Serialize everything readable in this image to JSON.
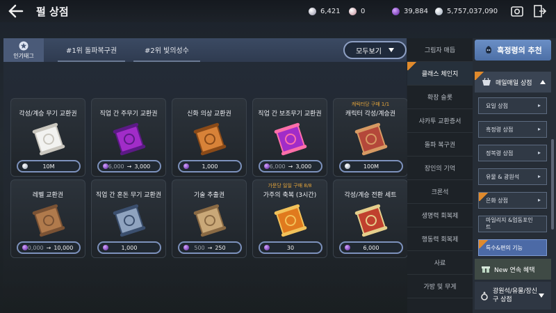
{
  "header": {
    "title": "펄 상점",
    "currencies": [
      {
        "icon": "pearl-icon",
        "value": "6,421",
        "color": "#c7c5d6"
      },
      {
        "icon": "pink-pearl-icon",
        "value": "0",
        "color": "#e4b6c1"
      },
      {
        "icon": "purple-gem-icon",
        "value": "39,884",
        "color": "#8e4fd6"
      },
      {
        "icon": "silver-coin-icon",
        "value": "5,757,037,090",
        "color": "#d5dae3"
      }
    ]
  },
  "tabs": {
    "popular_label": "인기태그",
    "tag1": "#1위 돌파복구권",
    "tag2": "#2위 빛의성수",
    "view_all": "모두보기"
  },
  "items": [
    {
      "name": "각성/계승 무기 교환권",
      "price": "10M",
      "icon": "silver-coin-icon"
    },
    {
      "name": "직업 간 주무기 교환권",
      "price_old": "6,000",
      "price_new": "3,000",
      "icon": "purple-gem-icon"
    },
    {
      "name": "신화 의상 교환권",
      "price": "1,000",
      "icon": "purple-gem-icon"
    },
    {
      "name": "직업 간 보조무기 교환권",
      "price_old": "6,000",
      "price_new": "3,000",
      "icon": "purple-gem-icon"
    },
    {
      "note": "캐릭터당 구매 1/1",
      "name": "캐릭터 각성/계승권",
      "price": "100M",
      "icon": "silver-coin-icon"
    },
    {
      "name": "레벨 교환권",
      "price_old": "20,000",
      "price_new": "10,000",
      "icon": "purple-gem-icon"
    },
    {
      "name": "직업 간 혼돈 무기 교환권",
      "price": "1,000",
      "icon": "purple-gem-icon"
    },
    {
      "name": "기술 추출권",
      "price_old": "500",
      "price_new": "250",
      "icon": "purple-gem-icon"
    },
    {
      "note": "가문당 일일 구매 8/8",
      "name": "가주의 축복 (3시간)",
      "price": "30",
      "icon": "purple-gem-icon"
    },
    {
      "name": "각성/계승 전환 세트",
      "price": "6,000",
      "icon": "purple-gem-icon"
    }
  ],
  "mid_nav": [
    "그림자 매듭",
    "클래스 체인지",
    "확장 슬롯",
    "샤카투 교환증서",
    "돌파 복구권",
    "장인의 기억",
    "크론석",
    "생명력 회복제",
    "행동력 회복제",
    "사료",
    "가방 및 무게"
  ],
  "right_nav": {
    "recommend": "흑정령의 추천",
    "daily": "매일매일 상점",
    "subitems": [
      "요일 상점",
      "흑정령 상점",
      "정복령 상점",
      "유물 & 광원석",
      "은화 상점",
      "마일리지 &업동포인트",
      "특수&편의 기능"
    ],
    "new_events": "New 연속 혜택",
    "bottom_category": "광원석/유물/장신구 상점"
  }
}
